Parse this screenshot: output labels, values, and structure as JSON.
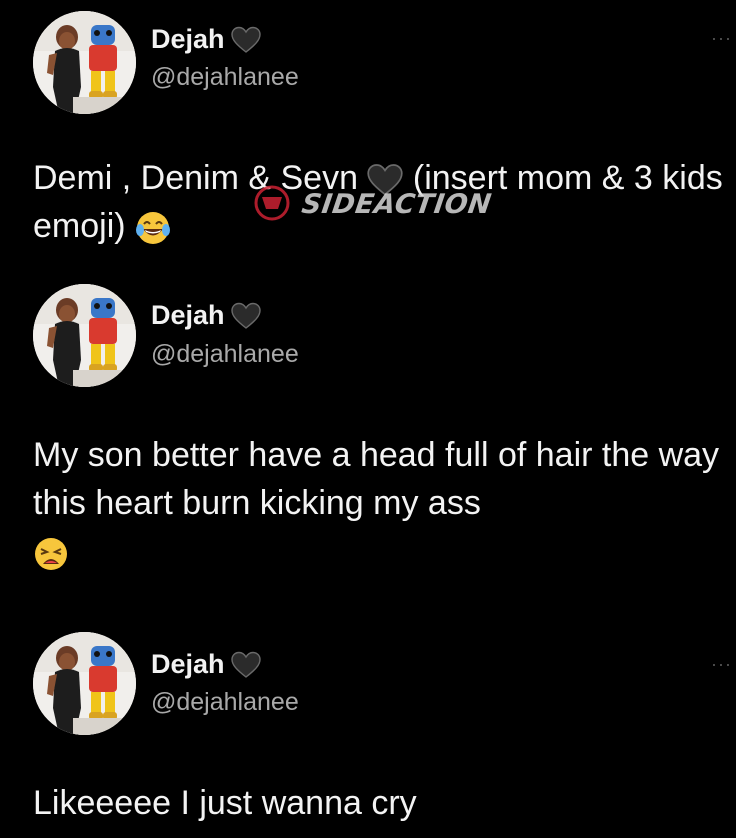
{
  "icons": {
    "heart": "black-heart-icon",
    "more": "more-options-icon",
    "laugh": "tears-of-joy-emoji",
    "weary": "weary-face-emoji"
  },
  "colors": {
    "background": "#000000",
    "name": "#f2f2f2",
    "handle": "#a9a9a9",
    "text": "#f3f3f3"
  },
  "tweets": [
    {
      "name": "Dejah",
      "handle": "@dejahlanee",
      "more": "···",
      "text_part1": "Demi , Denim & Sevn ",
      "text_part2": " (insert mom & 3 kids emoji) "
    },
    {
      "name": "Dejah",
      "handle": "@dejahlanee",
      "text": "My son better have a head full of hair the way this heart burn kicking my ass"
    },
    {
      "name": "Dejah",
      "handle": "@dejahlanee",
      "more": "···",
      "text": "Likeeeee I just wanna cry"
    }
  ],
  "watermark": {
    "text": "SIDEACTION"
  }
}
